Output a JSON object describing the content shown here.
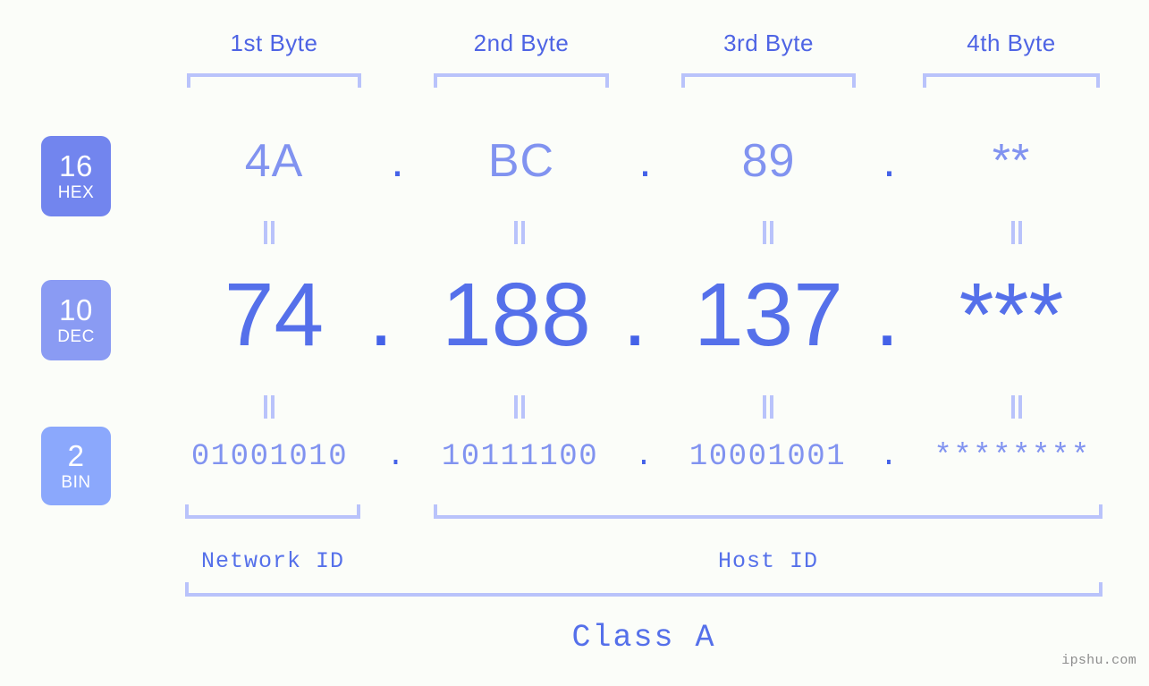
{
  "colors": {
    "background": "#fbfdf9",
    "badge_hex": "#7285ee",
    "badge_dec": "#8a9bf3",
    "badge_bin": "#8ba8fc",
    "bracket": "#b9c3fb",
    "text_strong": "#4e64e4",
    "text_light": "#8193f0",
    "text_dec": "#5570ea",
    "dot": "#4462e8",
    "watermark": "#8d8d8d"
  },
  "byte_headers": [
    {
      "label": "1st Byte"
    },
    {
      "label": "2nd Byte"
    },
    {
      "label": "3rd Byte"
    },
    {
      "label": "4th Byte"
    }
  ],
  "rows": [
    {
      "badge": {
        "num": "16",
        "abbr": "HEX"
      },
      "values": [
        "4A",
        "BC",
        "89",
        "**"
      ],
      "separator": "."
    },
    {
      "badge": {
        "num": "10",
        "abbr": "DEC"
      },
      "values": [
        "74",
        "188",
        "137",
        "***"
      ],
      "separator": "."
    },
    {
      "badge": {
        "num": "2",
        "abbr": "BIN"
      },
      "values": [
        "01001010",
        "10111100",
        "10001001",
        "********"
      ],
      "separator": "."
    }
  ],
  "sections": [
    {
      "label": "Network ID"
    },
    {
      "label": "Host ID"
    }
  ],
  "class": {
    "label": "Class A"
  },
  "watermark": {
    "text": "ipshu.com"
  }
}
